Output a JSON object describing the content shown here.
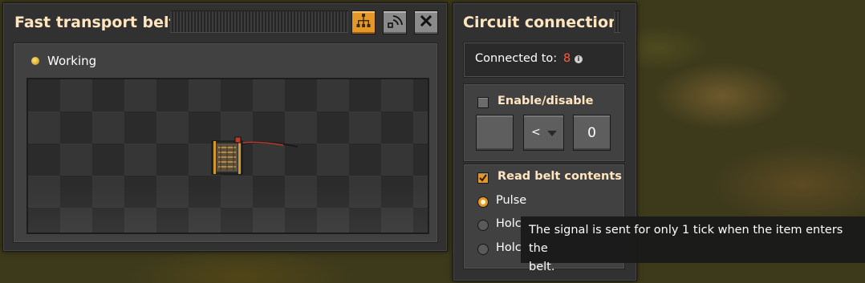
{
  "entity_window": {
    "title": "Fast transport belt",
    "status_text": "Working",
    "buttons": {
      "network_icon": "network-tree-icon",
      "wire_icon": "circuit-wire-icon",
      "close_icon": "close-icon"
    }
  },
  "circuit_window": {
    "title": "Circuit connection",
    "connected_label": "Connected to:",
    "connected_count": "8",
    "enable_disable": {
      "label": "Enable/disable",
      "checked": false,
      "operator": "<",
      "constant": "0"
    },
    "read_contents": {
      "label": "Read belt contents",
      "checked": true,
      "options": [
        {
          "label": "Pulse",
          "selected": true
        },
        {
          "label": "Hold",
          "selected": false
        },
        {
          "label": "Hold",
          "selected": false
        }
      ],
      "visible_prefix_1": "Holc",
      "visible_prefix_2": "Holc"
    }
  },
  "tooltip": {
    "line1": "The signal is sent for only 1 tick when the item enters the",
    "line2": "belt."
  },
  "colors": {
    "accent_orange": "#e39827",
    "title_text": "#ffe6c0",
    "count_red": "#ff5b3a",
    "status_yellow": "#f1c232"
  }
}
